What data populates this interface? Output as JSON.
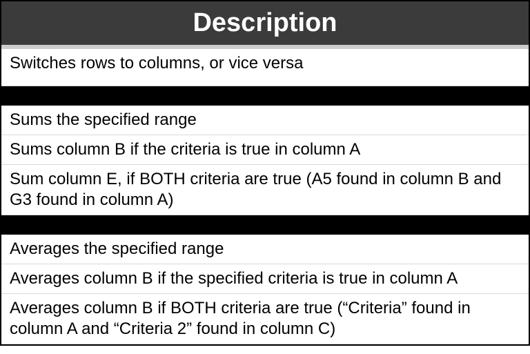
{
  "header": "Description",
  "groups": [
    {
      "rows": [
        "Switches rows to columns, or vice versa"
      ]
    },
    {
      "rows": [
        "Sums the specified range",
        "Sums column B if the criteria is true in column A",
        "Sum column E, if BOTH criteria are true (A5 found in column B and G3 found in column A)"
      ]
    },
    {
      "rows": [
        "Averages the specified range",
        "Averages column B if the specified criteria is true in column A",
        "Averages column B if BOTH criteria are true (“Criteria” found in column A and “Criteria 2” found in column C)"
      ]
    }
  ]
}
